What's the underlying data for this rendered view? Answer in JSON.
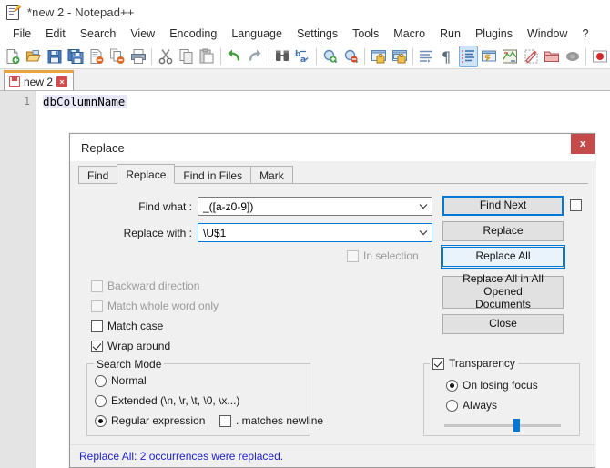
{
  "window": {
    "title": "*new 2 - Notepad++",
    "app_icon": "notepad-plus-plus-icon"
  },
  "menubar": {
    "items": [
      {
        "label": "File"
      },
      {
        "label": "Edit"
      },
      {
        "label": "Search"
      },
      {
        "label": "View"
      },
      {
        "label": "Encoding"
      },
      {
        "label": "Language"
      },
      {
        "label": "Settings"
      },
      {
        "label": "Tools"
      },
      {
        "label": "Macro"
      },
      {
        "label": "Run"
      },
      {
        "label": "Plugins"
      },
      {
        "label": "Window"
      },
      {
        "label": "?"
      }
    ]
  },
  "toolbar": {
    "buttons": [
      {
        "name": "new-file-icon"
      },
      {
        "name": "open-file-icon"
      },
      {
        "name": "save-icon"
      },
      {
        "name": "save-all-icon"
      },
      {
        "name": "close-file-icon"
      },
      {
        "name": "close-all-files-icon"
      },
      {
        "name": "print-icon"
      },
      {
        "name": "cut-icon"
      },
      {
        "name": "copy-icon"
      },
      {
        "name": "paste-icon"
      },
      {
        "name": "undo-icon"
      },
      {
        "name": "redo-icon"
      },
      {
        "name": "find-icon"
      },
      {
        "name": "replace-icon"
      },
      {
        "name": "zoom-in-icon"
      },
      {
        "name": "zoom-out-icon"
      },
      {
        "name": "sync-vertical-scroll-icon"
      },
      {
        "name": "sync-horizontal-scroll-icon"
      },
      {
        "name": "word-wrap-icon"
      },
      {
        "name": "show-all-characters-icon"
      },
      {
        "name": "indent-guide-icon"
      },
      {
        "name": "user-defined-dialog-icon"
      },
      {
        "name": "document-map-icon"
      },
      {
        "name": "function-list-icon"
      },
      {
        "name": "folder-as-workspace-icon"
      },
      {
        "name": "monitoring-icon"
      },
      {
        "name": "start-record-macro-icon"
      }
    ]
  },
  "tabbar": {
    "tabs": [
      {
        "label": "new 2",
        "modified": true,
        "close_glyph": "×"
      }
    ]
  },
  "editor": {
    "lines": [
      {
        "number": "1",
        "text": "dbColumnName",
        "current": true
      }
    ]
  },
  "dialog": {
    "title": "Replace",
    "close_glyph": "x",
    "tabs": [
      {
        "label": "Find",
        "selected": false
      },
      {
        "label": "Replace",
        "selected": true
      },
      {
        "label": "Find in Files",
        "selected": false
      },
      {
        "label": "Mark",
        "selected": false
      }
    ],
    "fields": {
      "find_what_label": "Find what :",
      "find_what_value": "_([a-z0-9])",
      "replace_with_label": "Replace with :",
      "replace_with_value": "\\U$1"
    },
    "buttons": {
      "find_next": "Find Next",
      "replace": "Replace",
      "replace_all": "Replace All",
      "replace_all_opened_line1": "Replace All in All Opened",
      "replace_all_opened_line2": "Documents",
      "close": "Close"
    },
    "options": {
      "in_selection": {
        "label": "In selection",
        "checked": false,
        "enabled": false
      },
      "backward_direction": {
        "label": "Backward direction",
        "checked": false,
        "enabled": false
      },
      "match_whole_word_only": {
        "label": "Match whole word only",
        "checked": false,
        "enabled": false
      },
      "match_case": {
        "label": "Match case",
        "checked": false,
        "enabled": true
      },
      "wrap_around": {
        "label": "Wrap around",
        "checked": true,
        "enabled": true
      }
    },
    "search_mode": {
      "legend": "Search Mode",
      "options": [
        {
          "label": "Normal",
          "selected": false
        },
        {
          "label": "Extended (\\n, \\r, \\t, \\0, \\x...)",
          "selected": false
        },
        {
          "label": "Regular expression",
          "selected": true
        }
      ],
      "dot_matches_newline": {
        "label": ". matches newline",
        "checked": false
      }
    },
    "transparency": {
      "label": "Transparency",
      "checked": true,
      "options": [
        {
          "label": "On losing focus",
          "selected": true
        },
        {
          "label": "Always",
          "selected": false
        }
      ],
      "slider_percent": 62
    },
    "status": "Replace All: 2 occurrences were replaced."
  },
  "colors": {
    "accent": "#0078d7",
    "close_button": "#c54b4b",
    "tab_highlight": "#e8a33d",
    "status_text": "#2222cc"
  }
}
